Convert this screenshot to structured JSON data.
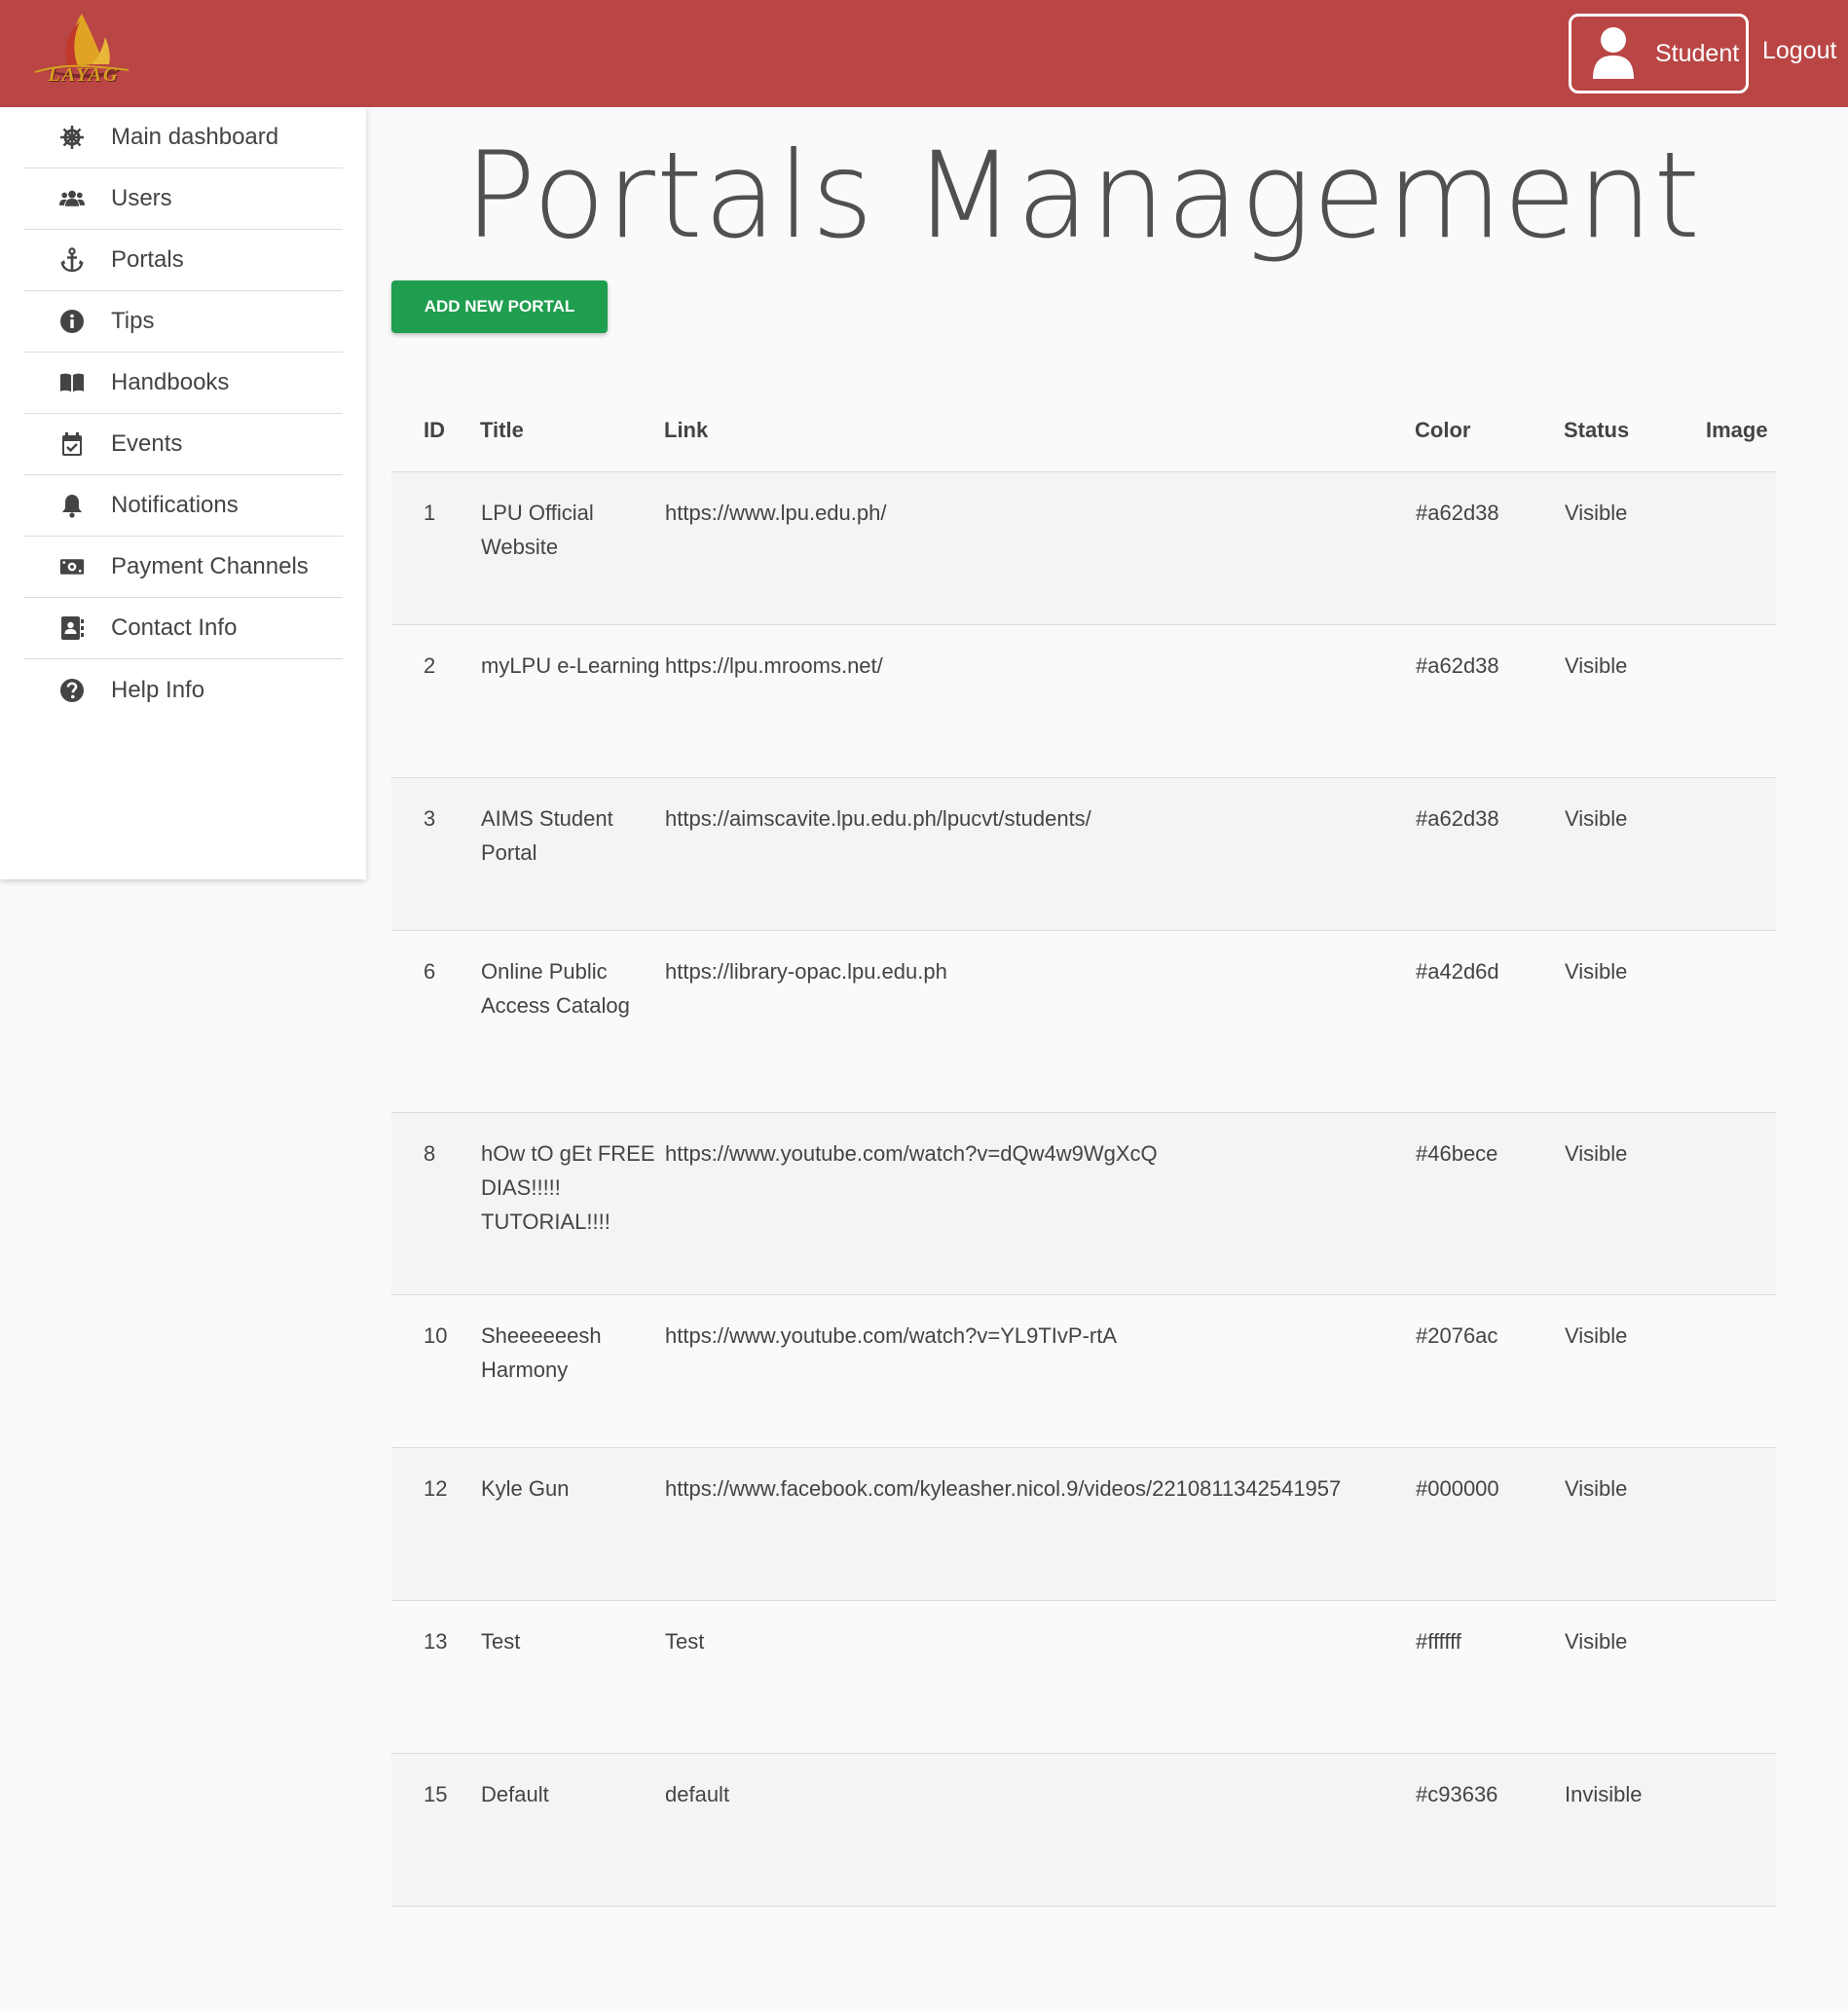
{
  "header": {
    "logo_text": "LAYAG",
    "user_label": "Student",
    "logout_label": "Logout"
  },
  "sidebar": {
    "items": [
      {
        "label": "Main dashboard",
        "icon": "helm-icon"
      },
      {
        "label": "Users",
        "icon": "users-icon"
      },
      {
        "label": "Portals",
        "icon": "anchor-icon"
      },
      {
        "label": "Tips",
        "icon": "info-icon"
      },
      {
        "label": "Handbooks",
        "icon": "book-icon"
      },
      {
        "label": "Events",
        "icon": "calendar-icon"
      },
      {
        "label": "Notifications",
        "icon": "bell-icon"
      },
      {
        "label": "Payment Channels",
        "icon": "money-icon"
      },
      {
        "label": "Contact Info",
        "icon": "contact-card-icon"
      },
      {
        "label": "Help Info",
        "icon": "question-icon"
      }
    ]
  },
  "main": {
    "title": "Portals Management",
    "add_button": "ADD NEW PORTAL",
    "table": {
      "headers": [
        "ID",
        "Title",
        "Link",
        "Color",
        "Status",
        "Image"
      ],
      "rows": [
        {
          "id": "1",
          "title": "LPU Official Website",
          "link": "https://www.lpu.edu.ph/",
          "color": "#a62d38",
          "status": "Visible"
        },
        {
          "id": "2",
          "title": "myLPU e-Learning",
          "link": "https://lpu.mrooms.net/",
          "color": "#a62d38",
          "status": "Visible"
        },
        {
          "id": "3",
          "title": "AIMS Student Portal",
          "link": "https://aimscavite.lpu.edu.ph/lpucvt/students/",
          "color": "#a62d38",
          "status": "Visible"
        },
        {
          "id": "6",
          "title": "Online Public Access Catalog",
          "link": "https://library-opac.lpu.edu.ph",
          "color": "#a42d6d",
          "status": "Visible"
        },
        {
          "id": "8",
          "title": "hOw tO gEt FREE DIAS!!!!! TUTORIAL!!!!",
          "link": "https://www.youtube.com/watch?v=dQw4w9WgXcQ",
          "color": "#46bece",
          "status": "Visible"
        },
        {
          "id": "10",
          "title": "Sheeeeeesh Harmony",
          "link": "https://www.youtube.com/watch?v=YL9TIvP-rtA",
          "color": "#2076ac",
          "status": "Visible"
        },
        {
          "id": "12",
          "title": "Kyle Gun",
          "link": "https://www.facebook.com/kyleasher.nicol.9/videos/2210811342541957",
          "color": "#000000",
          "status": "Visible"
        },
        {
          "id": "13",
          "title": "Test",
          "link": "Test",
          "color": "#ffffff",
          "status": "Visible"
        },
        {
          "id": "15",
          "title": "Default",
          "link": "default",
          "color": "#c93636",
          "status": "Invisible"
        }
      ]
    }
  },
  "theme": {
    "header_bg": "#b94545",
    "add_button_bg": "#1f9e4f"
  }
}
